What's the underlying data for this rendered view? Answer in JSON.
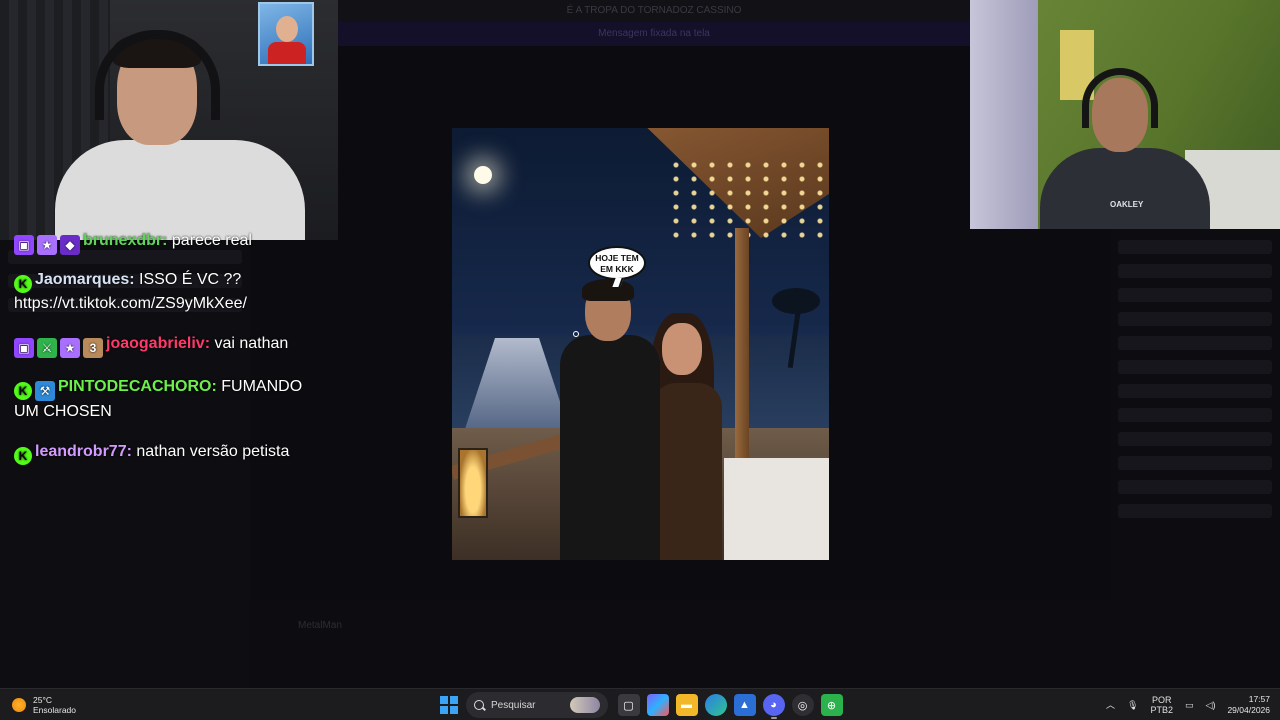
{
  "background_window": {
    "top_banner": "É A TROPA DO TORNADOZ CASSINO",
    "sub_banner": "Mensagem fixada na tela",
    "bottom_message": "MetalMan"
  },
  "chat": {
    "messages": [
      {
        "badges": [
          "twitch",
          "star",
          "diamond"
        ],
        "user": "brunexdbr:",
        "user_color": "#5fd35a",
        "text": " parece real",
        "partial": true
      },
      {
        "badges": [
          "kick"
        ],
        "user": "Jaomarques:",
        "user_color": "#d6e3f5",
        "text": " ISSO É VC ?? https://vt.tiktok.com/ZS9yMkXee/"
      },
      {
        "badges": [
          "twitch",
          "sword",
          "star",
          "sub"
        ],
        "user": "joaogabrieliv:",
        "user_color": "#ff3a6a",
        "text": " vai nathan"
      },
      {
        "badges": [
          "kick",
          "hammer"
        ],
        "user": "PINTODECACHORO:",
        "user_color": "#6cf04a",
        "text": " FUMANDO UM CHOSEN"
      },
      {
        "badges": [
          "kick"
        ],
        "user": "leandrobr77:",
        "user_color": "#d29bff",
        "text": " nathan versão petista"
      }
    ]
  },
  "photo": {
    "bubble_text": "HOJE TEM EM KKK"
  },
  "webcam_right": {
    "shirt_logo": "OAKLEY"
  },
  "taskbar": {
    "weather_temp": "25°C",
    "weather_desc": "Ensolarado",
    "search_placeholder": "Pesquisar",
    "language_line1": "POR",
    "language_line2": "PTB2",
    "time": "17:57",
    "date": "29/04/2026"
  }
}
